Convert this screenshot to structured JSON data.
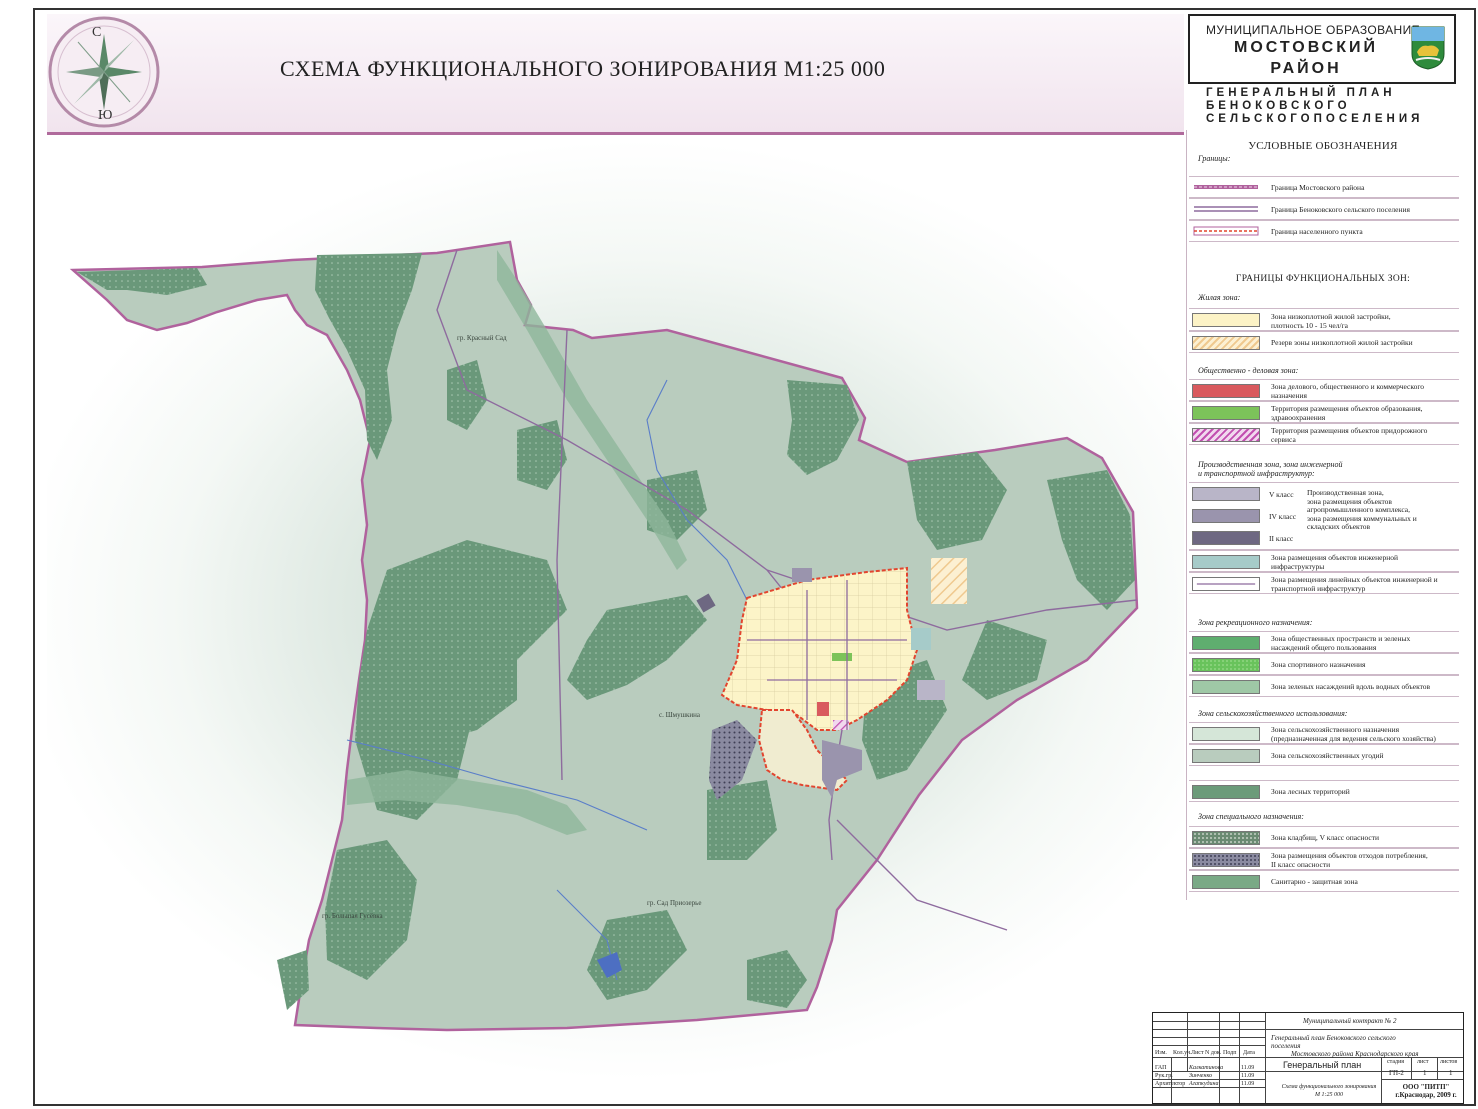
{
  "header": {
    "map_title": "СХЕМА ФУНКЦИОНАЛЬНОГО ЗОНИРОВАНИЯ  М1:25 000",
    "compass_north": "С",
    "compass_south": "Ю"
  },
  "title_block": {
    "municipal": "МУНИЦИПАЛЬНОЕ ОБРАЗОВАНИЕ",
    "district_line1": "МОСТОВСКИЙ",
    "district_line2": "РАЙОН",
    "plan_line1": "ГЕНЕРАЛЬНЫЙ ПЛАН",
    "plan_line2": "БЕНОКОВСКОГО",
    "plan_line3": "СЕЛЬСКОГОПОСЕЛЕНИЯ"
  },
  "legend": {
    "title": "УСЛОВНЫЕ ОБОЗНАЧЕНИЯ",
    "borders_heading": "Границы:",
    "borders": [
      "Граница Мостовского района",
      "Граница Беноковского сельского поселения",
      "Граница населенного пункта"
    ],
    "zones_title": "ГРАНИЦЫ ФУНКЦИОНАЛЬНЫХ ЗОН:",
    "residential_heading": "Жилая зона:",
    "residential": [
      {
        "line1": "Зона низкоплотной жилой застройки,",
        "line2": "плотность 10 - 15 чел/га"
      },
      {
        "line1": "Резерв зоны низкоплотной жилой застройки",
        "line2": ""
      }
    ],
    "business_heading": "Общественно - деловая зона:",
    "business": [
      {
        "line1": "Зона делового, общественного и коммерческого",
        "line2": "назначения"
      },
      {
        "line1": "Территория размещения объектов образования,",
        "line2": "здравоохранения"
      },
      {
        "line1": "Территория размещения объектов придорожного",
        "line2": "сервиса"
      }
    ],
    "production_heading_line1": "Производственная зона, зона инженерной",
    "production_heading_line2": "и транспортной инфраструктур:",
    "production_classes": [
      "V класс",
      "IV класс",
      "II класс"
    ],
    "production_desc": [
      "Производственная зона,",
      "зона размещения объектов",
      "агропромышленного комплекса,",
      "зона размещения коммунальных и",
      "складских объектов"
    ],
    "infrastructure": [
      {
        "line1": "Зона размещения объектов инженерной",
        "line2": "инфраструктуры"
      },
      {
        "line1": "Зона размещения линейных объектов инженерной и",
        "line2": "транспортной инфраструктур"
      }
    ],
    "recreation_heading": "Зона рекреационного назначения:",
    "recreation": [
      {
        "line1": "Зона общественных пространств и зеленых",
        "line2": "насаждений общего пользования"
      },
      {
        "line1": "Зона спортивного назначения",
        "line2": ""
      },
      {
        "line1": "Зона зеленых насаждений вдоль водных объектов",
        "line2": ""
      }
    ],
    "agri_heading": "Зона сельскохозяйственного использования:",
    "agri": [
      {
        "line1": "Зона сельскохозяйственного назначения",
        "line2": "(предназначенная для ведения сельского хозяйства)"
      },
      {
        "line1": "Зона сельскохозяйственных угодий",
        "line2": ""
      }
    ],
    "forest": "Зона лесных территорий",
    "special_heading": "Зона специального назначения:",
    "special": [
      {
        "line1": "Зона кладбищ, V класс опасности",
        "line2": ""
      },
      {
        "line1": "Зона размещения объектов отходов потребления,",
        "line2": "II класс опасности"
      },
      {
        "line1": "Санитарно - защитная зона",
        "line2": ""
      }
    ]
  },
  "stamp": {
    "contract": "Муниципальный контракт № 2",
    "project_line1": "Генеральный план Беноковского сельского",
    "project_line2": "поселения",
    "project_line3": "Мостовского района Краснодарского края",
    "columns": [
      "Изм.",
      "Кол.уч.",
      "Лист",
      "N док.",
      "Подп",
      "Дата"
    ],
    "roles": [
      {
        "role": "ГАП",
        "name": "Калкатинова",
        "date": "11.09"
      },
      {
        "role": "Рук.гр.",
        "name": "Зинченко",
        "date": "11.09"
      },
      {
        "role": "Архитектор",
        "name": "Агапкудина",
        "date": "11.09"
      }
    ],
    "sheet_title": "Генеральный план",
    "stage_label": "стадия",
    "sheet_label": "лист",
    "sheets_label": "листов",
    "stage": "ГП-2",
    "sheet": "1",
    "sheets": "1",
    "drawing_line1": "Схема функционального зонирования",
    "drawing_line2": "М 1:25 000",
    "org_line1": "ООО \"ПИТП\"",
    "org_line2": "г.Краснодар, 2009 г."
  },
  "map_labels": [
    "гр. Красный Сад",
    "гр. Сад Приозерье",
    "с. Шмушкина",
    "гр. Большая Гусёвка"
  ],
  "colors": {
    "forest": "#6c9b7a",
    "agri": "#b9ccbe",
    "residential": "#fcf3c6",
    "district_border": "#b0629d",
    "settlement_border": "#e2452f",
    "business": "#d95a5e",
    "education": "#7cc35a",
    "production_v": "#b9b5c8",
    "production_iv": "#9a94ad",
    "production_ii": "#6e6882",
    "engineering": "#a6cbc9"
  }
}
